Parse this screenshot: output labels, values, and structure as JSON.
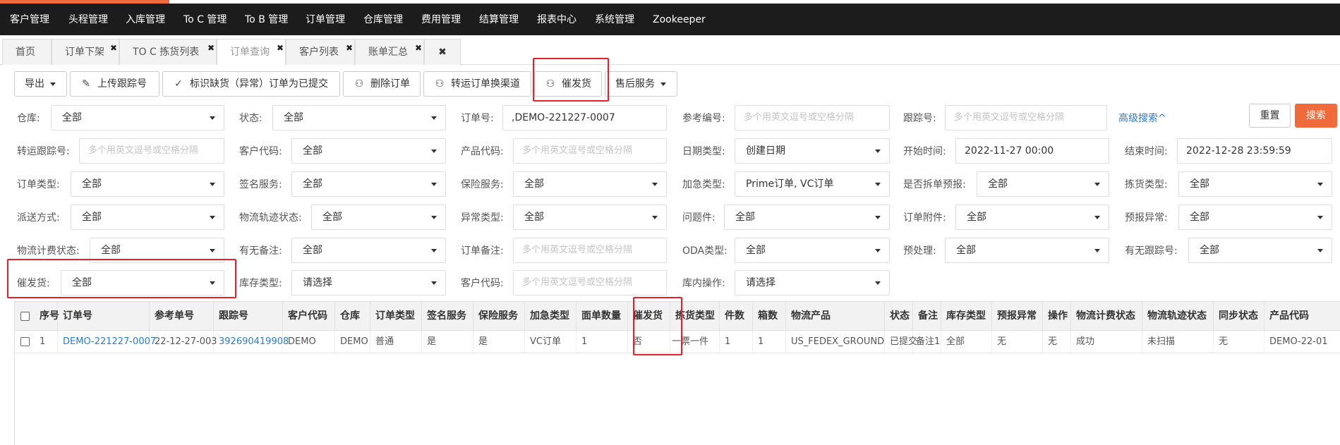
{
  "topnav": {
    "items": [
      "客户管理",
      "头程管理",
      "入库管理",
      "To C 管理",
      "To B 管理",
      "订单管理",
      "仓库管理",
      "费用管理",
      "结算管理",
      "报表中心",
      "系统管理",
      "Zookeeper"
    ]
  },
  "tabs": [
    {
      "label": "首页",
      "closable": false
    },
    {
      "label": "订单下架",
      "closable": true
    },
    {
      "label": "TO C 拣货列表",
      "closable": true
    },
    {
      "label": "订单查询",
      "closable": true,
      "active": true
    },
    {
      "label": "客户列表",
      "closable": true
    },
    {
      "label": "账单汇总",
      "closable": true
    }
  ],
  "close_all_icon": "✖",
  "tab_close_icon": "✖",
  "toolbar": {
    "export": "导出",
    "upload_tracking": "上传跟踪号",
    "mark_shortage": "标识缺货（异常）订单为已提交",
    "delete_order": "删除订单",
    "transfer_channel": "转运订单换渠道",
    "urge": "催发货",
    "after_sales": "售后服务"
  },
  "filters": {
    "warehouse": {
      "label": "仓库:",
      "value": "全部"
    },
    "status": {
      "label": "状态:",
      "value": "全部"
    },
    "order_no": {
      "label": "订单号:",
      "value": ",DEMO-221227-0007"
    },
    "ref_no": {
      "label": "参考编号:",
      "placeholder": "多个用英文逗号或空格分隔"
    },
    "tracking_no": {
      "label": "跟踪号:",
      "placeholder": "多个用英文逗号或空格分隔"
    },
    "advanced": "高级搜索^",
    "reset": "重置",
    "search": "搜索",
    "transfer_tracking": {
      "label": "转运跟踪号:",
      "placeholder": "多个用英文逗号或空格分隔"
    },
    "customer_code": {
      "label": "客户代码:",
      "value": "全部"
    },
    "product_code": {
      "label": "产品代码:",
      "placeholder": "多个用英文逗号或空格分隔"
    },
    "date_type": {
      "label": "日期类型:",
      "value": "创建日期"
    },
    "start_time": {
      "label": "开始时间:",
      "value": "2022-11-27 00:00"
    },
    "end_time": {
      "label": "结束时间:",
      "value": "2022-12-28 23:59:59"
    },
    "order_type": {
      "label": "订单类型:",
      "value": "全部"
    },
    "sign_service": {
      "label": "签名服务:",
      "value": "全部"
    },
    "insurance": {
      "label": "保险服务:",
      "value": "全部"
    },
    "urgent_type": {
      "label": "加急类型:",
      "value": "Prime订单, VC订单"
    },
    "split_prereport": {
      "label": "是否拆单预报:",
      "value": "全部"
    },
    "pick_type": {
      "label": "拣货类型:",
      "value": "全部"
    },
    "delivery": {
      "label": "派送方式:",
      "value": "全部"
    },
    "logistics_track": {
      "label": "物流轨迹状态:",
      "value": "全部"
    },
    "exception_type": {
      "label": "异常类型:",
      "value": "全部"
    },
    "problem": {
      "label": "问题件:",
      "value": "全部"
    },
    "attachment": {
      "label": "订单附件:",
      "value": "全部"
    },
    "prereport_exception": {
      "label": "预报异常:",
      "value": "全部"
    },
    "billing_status": {
      "label": "物流计费状态:",
      "value": "全部"
    },
    "has_remark": {
      "label": "有无备注:",
      "value": "全部"
    },
    "order_remark": {
      "label": "订单备注:",
      "placeholder": "多个用英文逗号或空格分隔"
    },
    "oda_type": {
      "label": "ODA类型:",
      "value": "全部"
    },
    "preprocess": {
      "label": "预处理:",
      "value": "全部"
    },
    "has_tracking": {
      "label": "有无跟踪号:",
      "value": "全部"
    },
    "urge": {
      "label": "催发货:",
      "value": "全部"
    },
    "stock_type": {
      "label": "库存类型:",
      "value": "请选择"
    },
    "customer_code2": {
      "label": "客户代码:",
      "placeholder": "多个用英文逗号或空格分隔"
    },
    "in_warehouse_op": {
      "label": "库内操作:",
      "value": "请选择"
    }
  },
  "table": {
    "headers": [
      "序号",
      "订单号",
      "参考单号",
      "跟踪号",
      "客户代码",
      "仓库",
      "订单类型",
      "签名服务",
      "保险服务",
      "加急类型",
      "面单数量",
      "催发货",
      "拣货类型",
      "件数",
      "箱数",
      "物流产品",
      "状态",
      "备注",
      "库存类型",
      "预报异常",
      "操作",
      "物流计费状态",
      "物流轨迹状态",
      "同步状态",
      "产品代码"
    ],
    "rows": [
      [
        "1",
        "DEMO-221227-0007",
        "22-12-27-003",
        "392690419908",
        "DEMO",
        "DEMO",
        "普通",
        "是",
        "是",
        "VC订单",
        "1",
        "否",
        "一票一件",
        "1",
        "1",
        "US_FEDEX_GROUND",
        "已提交",
        "备注1",
        "全部",
        "无",
        "无",
        "成功",
        "未扫描",
        "无",
        "DEMO-22-01"
      ]
    ]
  },
  "colors": {
    "accent": "#ef6b3b",
    "link": "#2b7bd8",
    "highlight": "#e8202a",
    "nav_bg": "#1c1c1c"
  }
}
